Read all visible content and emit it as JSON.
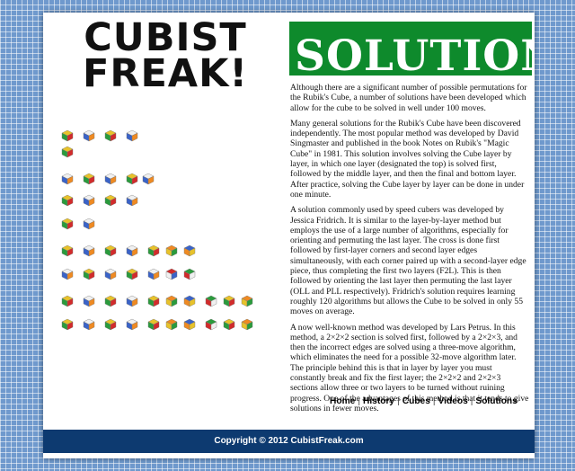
{
  "site": {
    "logo_line1": "CUBIST",
    "logo_line2": "FREAK!"
  },
  "banner": {
    "title": "SOLUTIONS"
  },
  "article": {
    "paragraphs": [
      "Although there are a significant number of possible permutations for the Rubik's Cube, a number of solutions have been developed which allow for the cube to be solved in well under 100 moves.",
      "Many general solutions for the Rubik's Cube have been discovered independently. The most popular method was developed by David Singmaster and published in the book Notes on Rubik's \"Magic Cube\" in 1981. This solution involves solving the Cube layer by layer, in which one layer (designated the top) is solved first, followed by the middle layer, and then the final and bottom layer. After practice, solving the Cube layer by layer can be done in under one minute.",
      "A solution commonly used by speed cubers was developed by Jessica Fridrich. It is similar to the layer-by-layer method but employs the use of a large number of algorithms, especially for orienting and permuting the last layer. The cross is done first followed by first-layer corners and second layer edges simultaneously, with each corner paired up with a second-layer edge piece, thus completing the first two layers (F2L). This is then followed by orienting the last layer then permuting the last layer (OLL and PLL respectively). Fridrich's solution requires learning roughly 120 algorithms but allows the Cube to be solved in only 55 moves on average.",
      "A now well-known method was developed by Lars Petrus. In this method, a 2×2×2 section is solved first, followed by a 2×2×3, and then the incorrect edges are solved using a three-move algorithm, which eliminates the need for a possible 32-move algorithm later. The principle behind this is that in layer by layer you must constantly break and fix the first layer; the 2×2×2 and 2×2×3 sections allow three or two layers to be turned without ruining progress. One of the advantages of this method is that it tends to give solutions in fewer moves."
    ]
  },
  "nav": {
    "home": "Home",
    "history": "History",
    "cubes": "Cubes",
    "videos": "Videos",
    "solutions": "Solutions",
    "separator": "|"
  },
  "footer": {
    "copyright": "Copyright © 2012 CubistFreak.com"
  },
  "colors": {
    "background": "#6f99cd",
    "banner": "#0e8a2c",
    "footer": "#0d3a70"
  },
  "icons": [
    "rubiks-cube-icon"
  ]
}
